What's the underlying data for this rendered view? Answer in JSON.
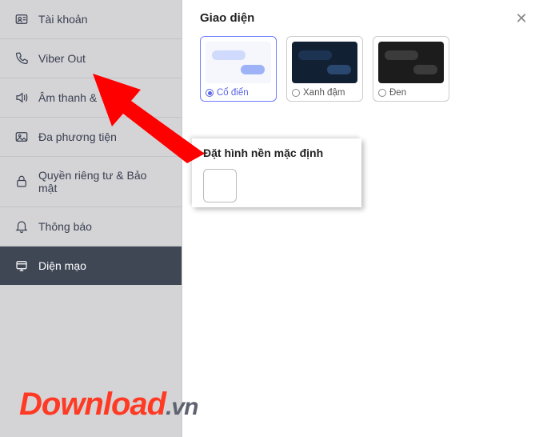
{
  "sidebar": {
    "items": [
      {
        "label": "Tài khoản",
        "icon": "account-icon"
      },
      {
        "label": "Viber Out",
        "icon": "phone-icon"
      },
      {
        "label": "Âm thanh & Video",
        "icon": "speaker-icon"
      },
      {
        "label": "Đa phương tiện",
        "icon": "image-icon"
      },
      {
        "label": "Quyền riêng tư & Bảo mật",
        "icon": "lock-icon"
      },
      {
        "label": "Thông báo",
        "icon": "bell-icon"
      },
      {
        "label": "Diện mạo",
        "icon": "appearance-icon",
        "active": true
      }
    ]
  },
  "main": {
    "section_title": "Giao diện",
    "themes": [
      {
        "label": "Cổ điển",
        "selected": true,
        "variant": "light"
      },
      {
        "label": "Xanh đậm",
        "selected": false,
        "variant": "darkblue"
      },
      {
        "label": "Đen",
        "selected": false,
        "variant": "black"
      }
    ],
    "background_section_label": "Đặt hình nền mặc định"
  },
  "watermark": {
    "main": "Download",
    "tld": ".vn"
  },
  "colors": {
    "accent": "#6e7bff",
    "arrow": "#ff0000",
    "sidebar_active": "#3f4755"
  }
}
